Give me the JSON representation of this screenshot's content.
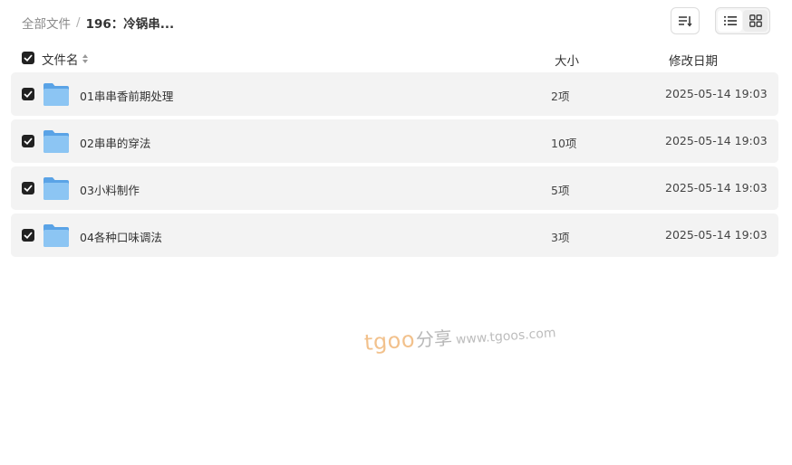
{
  "breadcrumb": {
    "root": "全部文件",
    "separator": "/",
    "current": "196：冷锅串..."
  },
  "toolbar": {
    "sort_icon": "sort-icon",
    "list_view_icon": "list-view-icon",
    "grid_view_icon": "grid-view-icon",
    "active_view": "list"
  },
  "table": {
    "headers": {
      "name": "文件名",
      "size": "大小",
      "date": "修改日期"
    },
    "rows": [
      {
        "name": "01串串香前期处理",
        "size": "2项",
        "date": "2025-05-14 19:03",
        "checked": true
      },
      {
        "name": "02串串的穿法",
        "size": "10项",
        "date": "2025-05-14 19:03",
        "checked": true
      },
      {
        "name": "03小料制作",
        "size": "5项",
        "date": "2025-05-14 19:03",
        "checked": true
      },
      {
        "name": "04各种口味调法",
        "size": "3项",
        "date": "2025-05-14 19:03",
        "checked": true
      }
    ]
  },
  "watermark": {
    "brand": "tgoo",
    "cn": "分享",
    "url": "www.tgoos.com"
  },
  "colors": {
    "folder": "#7cb8ef",
    "checkbox": "#222222",
    "row_bg": "#f3f3f3"
  }
}
